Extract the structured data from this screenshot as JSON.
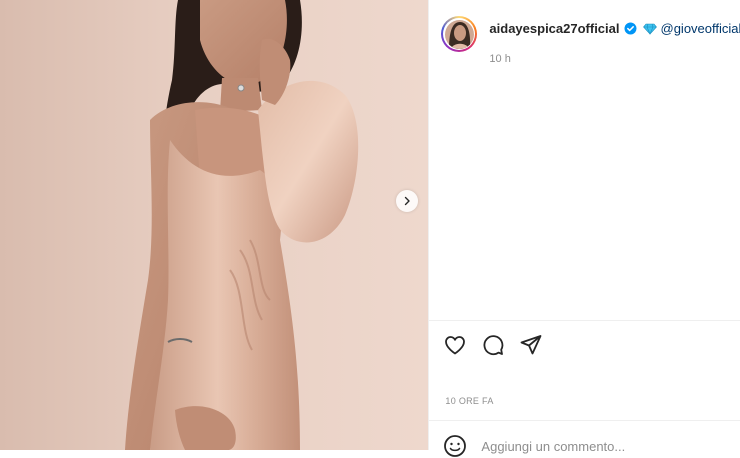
{
  "post": {
    "username": "aidayespica27official",
    "mention": "@gioveofficial",
    "time_ago": "10 h",
    "date_label": "10 ORE FA",
    "comment_placeholder": "Aggiungi un commento..."
  },
  "icons": {
    "verified": "verified-badge-icon",
    "gem": "gem-icon",
    "next": "chevron-right-icon",
    "like": "heart-icon",
    "comment": "comment-bubble-icon",
    "share": "paper-plane-icon",
    "emoji": "emoji-icon"
  },
  "colors": {
    "verified": "#0095f6",
    "gem": "#3ec3f0",
    "mention": "#00376b",
    "muted": "#8e8e8e",
    "text": "#262626",
    "divider": "#efefef",
    "photo_backdrop": "#e8cfc3"
  }
}
